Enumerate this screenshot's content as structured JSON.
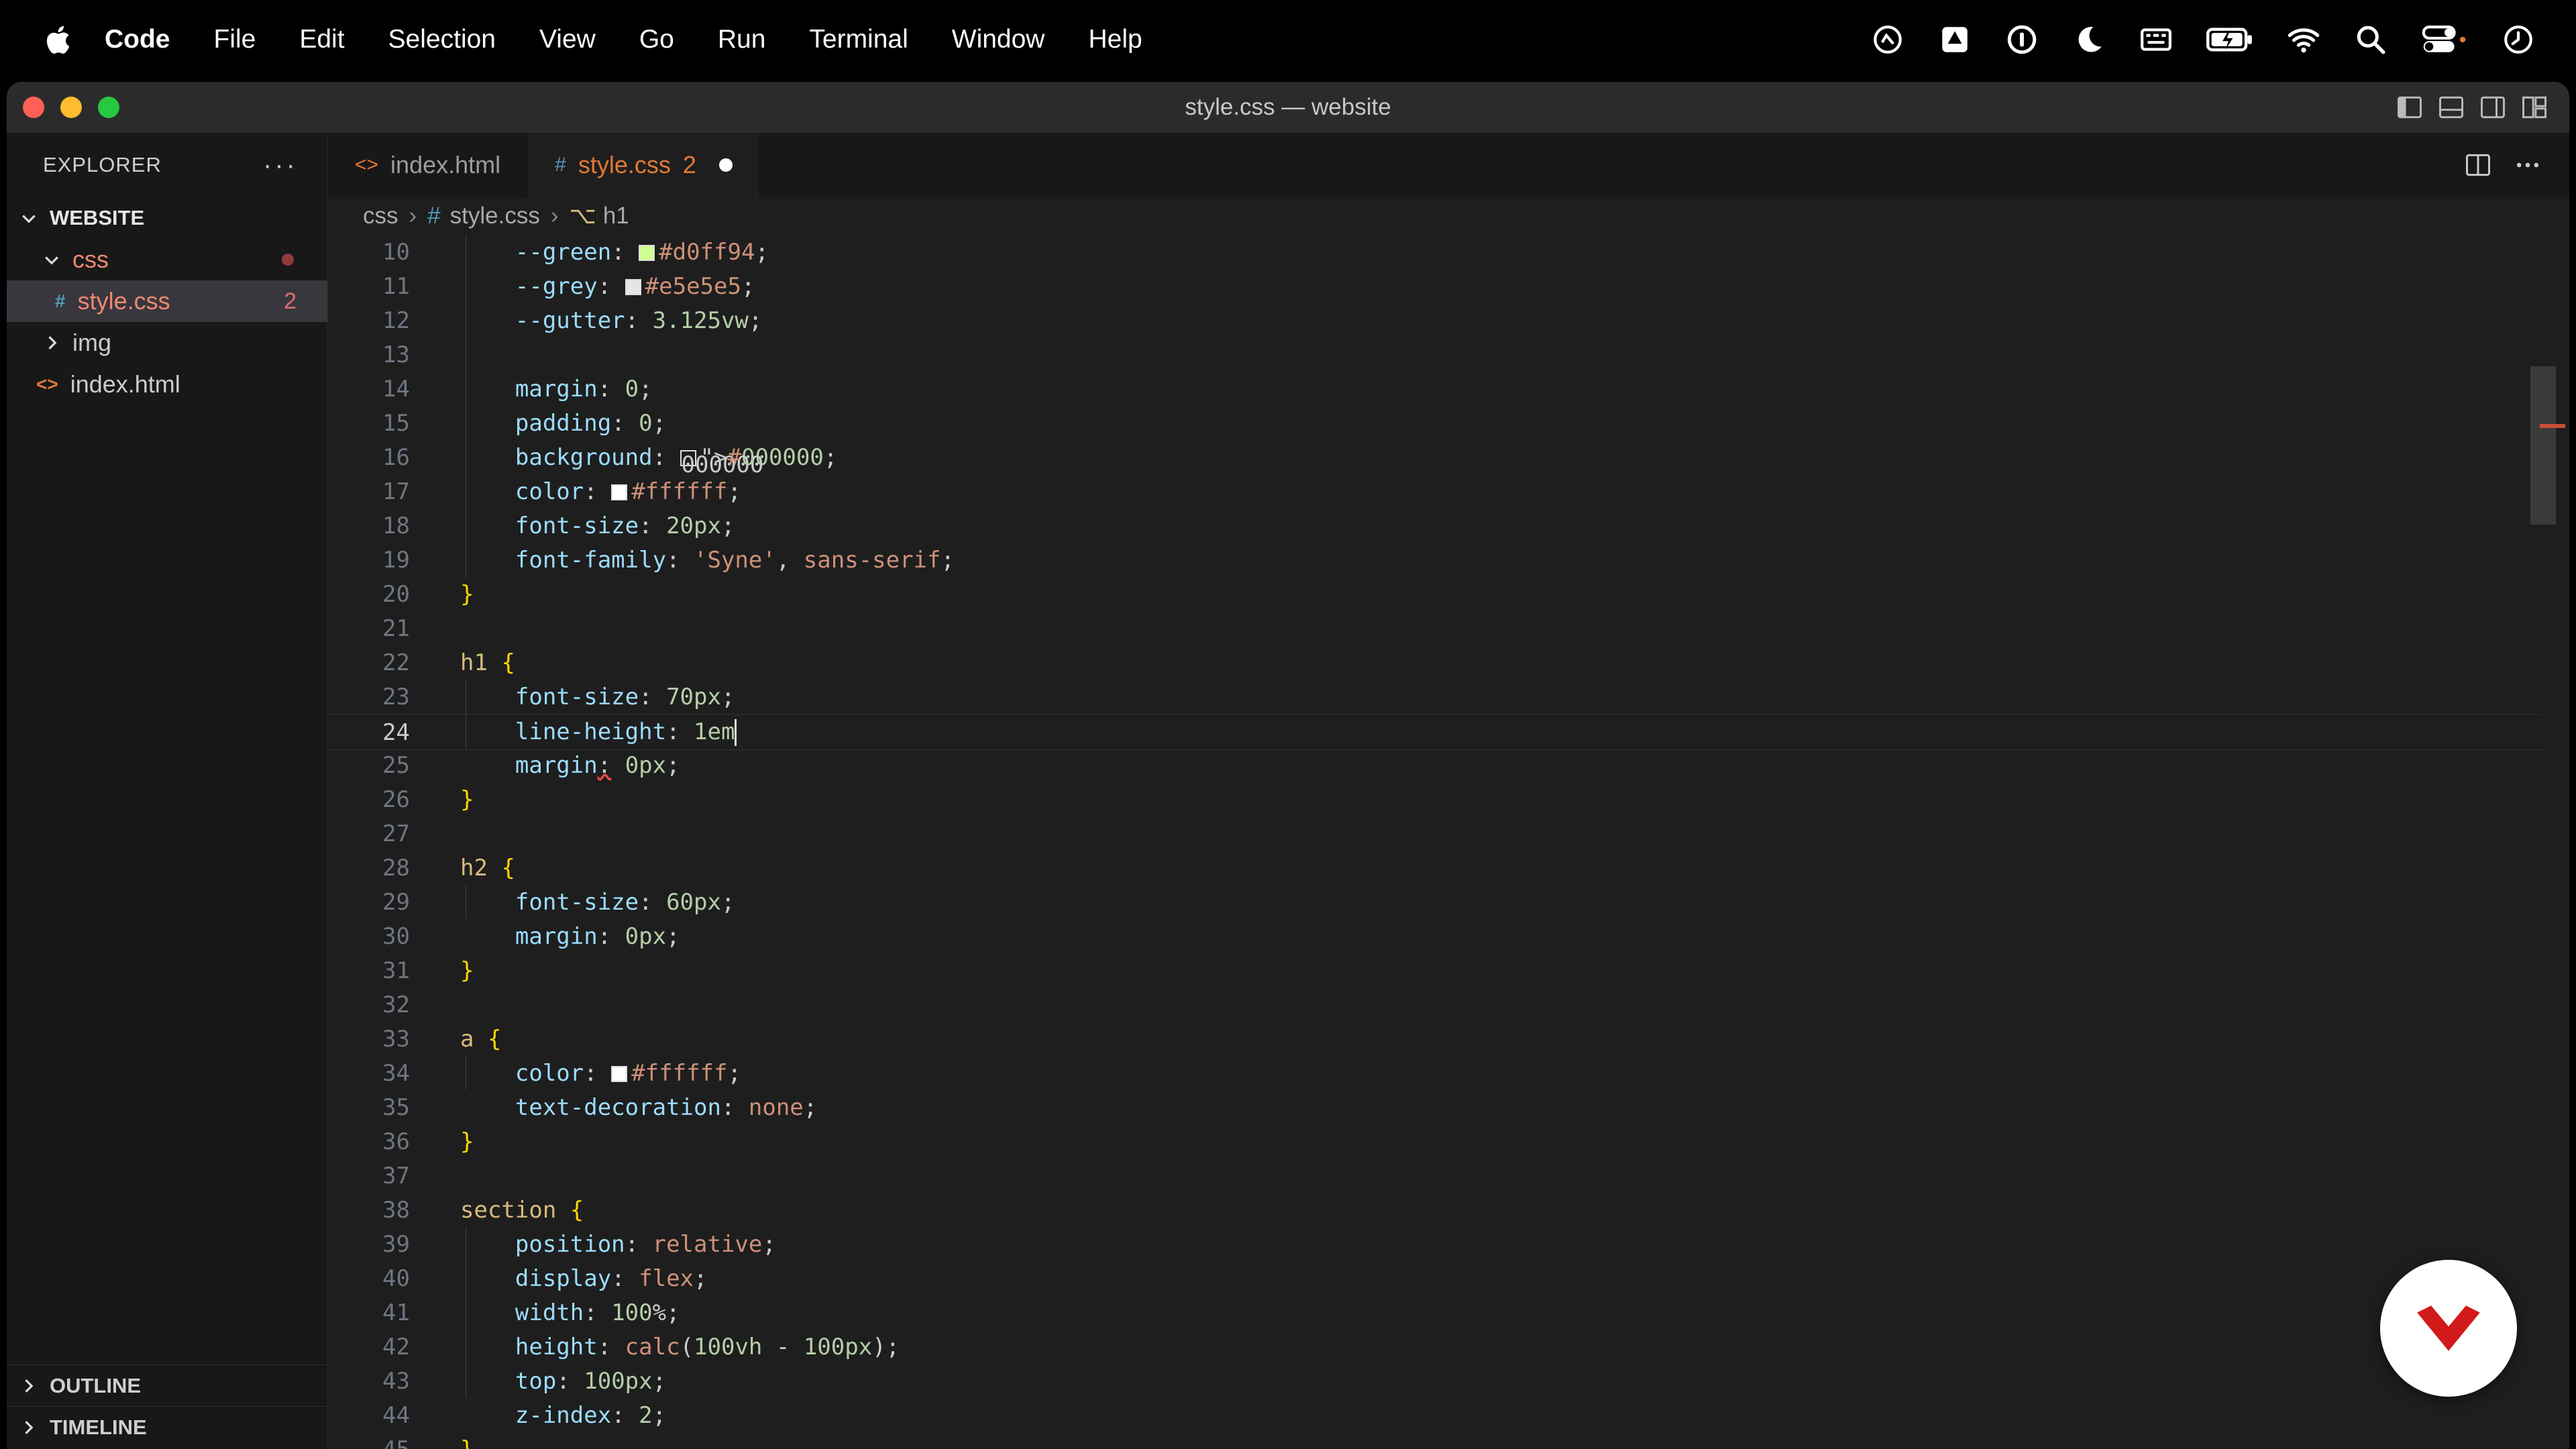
{
  "menubar": {
    "app": "Code",
    "items": [
      "File",
      "Edit",
      "Selection",
      "View",
      "Go",
      "Run",
      "Terminal",
      "Window",
      "Help"
    ],
    "status_icons": [
      "shield-check-icon",
      "drive-icon",
      "one-password-icon",
      "moon-icon",
      "keyboard-icon",
      "battery-icon",
      "wifi-icon",
      "search-icon",
      "control-center-icon",
      "clock-icon"
    ]
  },
  "window": {
    "title": "style.css — website"
  },
  "sidebar": {
    "header": "EXPLORER",
    "more": "···",
    "root": "WEBSITE",
    "items": [
      {
        "label": "css",
        "type": "folder",
        "expanded": true
      },
      {
        "label": "style.css",
        "type": "file",
        "badge": "2",
        "selected": true
      },
      {
        "label": "img",
        "type": "folder",
        "expanded": false
      },
      {
        "label": "index.html",
        "type": "file"
      }
    ],
    "outline": "OUTLINE",
    "timeline": "TIMELINE"
  },
  "tabs": [
    {
      "label": "index.html",
      "icon": "<>",
      "active": false
    },
    {
      "label": "style.css",
      "icon": "#",
      "badge": "2",
      "active": true,
      "dirty": true
    }
  ],
  "breadcrumb": [
    "css",
    "style.css",
    "h1"
  ],
  "code": {
    "current_line": 24,
    "lines": [
      {
        "n": "10",
        "text": "    --green: #d0ff94;"
      },
      {
        "n": "11",
        "text": "    --grey: #e5e5e5;"
      },
      {
        "n": "12",
        "text": "    --gutter: 3.125vw;"
      },
      {
        "n": "13",
        "text": ""
      },
      {
        "n": "14",
        "text": "    margin: 0;"
      },
      {
        "n": "15",
        "text": "    padding: 0;"
      },
      {
        "n": "16",
        "text": "    background: #000000;"
      },
      {
        "n": "17",
        "text": "    color: #ffffff;"
      },
      {
        "n": "18",
        "text": "    font-size: 20px;"
      },
      {
        "n": "19",
        "text": "    font-family: 'Syne', sans-serif;"
      },
      {
        "n": "20",
        "text": "}"
      },
      {
        "n": "21",
        "text": ""
      },
      {
        "n": "22",
        "text": "h1 {"
      },
      {
        "n": "23",
        "text": "    font-size: 70px;"
      },
      {
        "n": "24",
        "text": "    line-height: 1em"
      },
      {
        "n": "25",
        "text": "    margin: 0px;"
      },
      {
        "n": "26",
        "text": "}"
      },
      {
        "n": "27",
        "text": ""
      },
      {
        "n": "28",
        "text": "h2 {"
      },
      {
        "n": "29",
        "text": "    font-size: 60px;"
      },
      {
        "n": "30",
        "text": "    margin: 0px;"
      },
      {
        "n": "31",
        "text": "}"
      },
      {
        "n": "32",
        "text": ""
      },
      {
        "n": "33",
        "text": "a {"
      },
      {
        "n": "34",
        "text": "    color: #ffffff;"
      },
      {
        "n": "35",
        "text": "    text-decoration: none;"
      },
      {
        "n": "36",
        "text": "}"
      },
      {
        "n": "37",
        "text": ""
      },
      {
        "n": "38",
        "text": "section {"
      },
      {
        "n": "39",
        "text": "    position: relative;"
      },
      {
        "n": "40",
        "text": "    display: flex;"
      },
      {
        "n": "41",
        "text": "    width: 100%;"
      },
      {
        "n": "42",
        "text": "    height: calc(100vh - 100px);"
      },
      {
        "n": "43",
        "text": "    top: 100px;"
      },
      {
        "n": "44",
        "text": "    z-index: 2;"
      },
      {
        "n": "45",
        "text": "}"
      }
    ]
  },
  "colors": {
    "accent_orange": "#e37933",
    "error_red": "#f14c4c",
    "editor_bg": "#1e1e1e",
    "sidebar_bg": "#181818"
  }
}
